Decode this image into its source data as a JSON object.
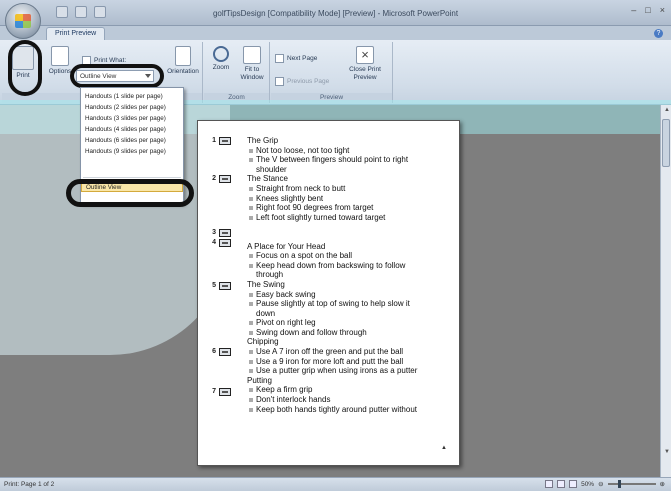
{
  "window": {
    "title": "golfTipsDesign [Compatibility Mode] [Preview] - Microsoft PowerPoint",
    "controls": [
      "–",
      "□",
      "×"
    ]
  },
  "tabs": [
    {
      "label": "Print Preview"
    }
  ],
  "ribbon": {
    "print_group": {
      "label": "Print",
      "print_label": "Print",
      "options_label": "Options",
      "print_what_label": "Print What:",
      "print_what_value": "Outline View",
      "orientation_label": "Orientation"
    },
    "zoom_group": {
      "label": "Zoom",
      "zoom_label": "Zoom",
      "fit_label": "Fit to Window"
    },
    "preview_group": {
      "label": "Preview",
      "next_label": "Next Page",
      "prev_label": "Previous Page",
      "close_label": "Close Print Preview"
    }
  },
  "dropdown": {
    "items": [
      "Handouts (1 slide per page)",
      "Handouts (2 slides per page)",
      "Handouts (3 slides per page)",
      "Handouts (4 slides per page)",
      "Handouts (6 slides per page)",
      "Handouts (9 slides per page)"
    ],
    "selected": "Outline View"
  },
  "outline": {
    "slide_numbers": [
      "1",
      "2",
      "3",
      "4",
      "5",
      "6",
      "7"
    ],
    "lines": [
      {
        "kind": "title",
        "text": "The Grip"
      },
      {
        "kind": "bullet",
        "text": "Not too loose, not too tight"
      },
      {
        "kind": "bullet",
        "text": "The V between fingers should point to right"
      },
      {
        "kind": "cont",
        "text": "shoulder"
      },
      {
        "kind": "title",
        "text": "The Stance"
      },
      {
        "kind": "bullet",
        "text": "Straight from neck to butt"
      },
      {
        "kind": "bullet",
        "text": "Knees slightly bent"
      },
      {
        "kind": "bullet",
        "text": "Right foot 90 degrees from target"
      },
      {
        "kind": "bullet",
        "text": "Left foot slightly turned toward target"
      },
      {
        "kind": "blank",
        "text": ""
      },
      {
        "kind": "blank",
        "text": ""
      },
      {
        "kind": "title",
        "text": "A Place for Your Head"
      },
      {
        "kind": "bullet",
        "text": "Focus on a spot on the ball"
      },
      {
        "kind": "bullet",
        "text": "Keep head down from backswing to follow"
      },
      {
        "kind": "cont",
        "text": "through"
      },
      {
        "kind": "title",
        "text": "The Swing"
      },
      {
        "kind": "bullet",
        "text": "Easy back swing"
      },
      {
        "kind": "bullet",
        "text": "Pause slightly at top of swing to help slow it"
      },
      {
        "kind": "cont",
        "text": "down"
      },
      {
        "kind": "bullet",
        "text": "Pivot on right leg"
      },
      {
        "kind": "bullet",
        "text": "Swing down and follow through"
      },
      {
        "kind": "title",
        "text": "Chipping"
      },
      {
        "kind": "bullet",
        "text": "Use A 7 iron off the green and put the ball"
      },
      {
        "kind": "bullet",
        "text": "Use a 9 iron for more loft and putt the ball"
      },
      {
        "kind": "bullet",
        "text": "Use a putter grip when using irons as a putter"
      },
      {
        "kind": "title",
        "text": "Putting"
      },
      {
        "kind": "bullet",
        "text": "Keep a firm grip"
      },
      {
        "kind": "bullet",
        "text": "Don't interlock hands"
      },
      {
        "kind": "bullet",
        "text": "Keep both hands tightly around putter without"
      }
    ]
  },
  "status": {
    "page": "Print: Page 1 of 2",
    "zoom": "50%"
  }
}
